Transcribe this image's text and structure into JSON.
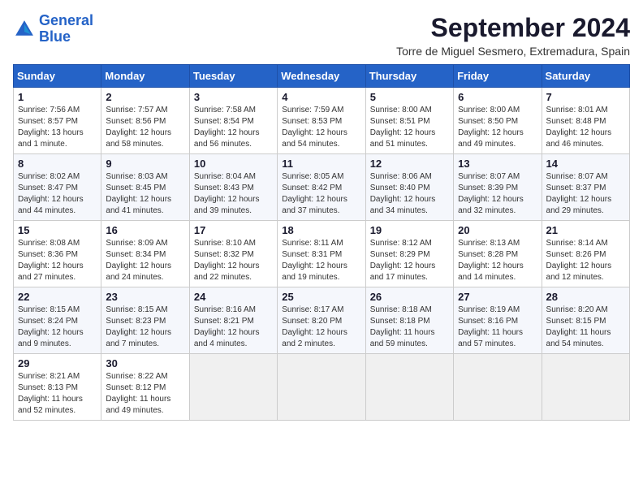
{
  "header": {
    "logo_line1": "General",
    "logo_line2": "Blue",
    "title": "September 2024",
    "subtitle": "Torre de Miguel Sesmero, Extremadura, Spain"
  },
  "weekdays": [
    "Sunday",
    "Monday",
    "Tuesday",
    "Wednesday",
    "Thursday",
    "Friday",
    "Saturday"
  ],
  "weeks": [
    [
      {
        "day": "1",
        "sr": "7:56 AM",
        "ss": "8:57 PM",
        "dl": "13 hours and 1 minute."
      },
      {
        "day": "2",
        "sr": "7:57 AM",
        "ss": "8:56 PM",
        "dl": "12 hours and 58 minutes."
      },
      {
        "day": "3",
        "sr": "7:58 AM",
        "ss": "8:54 PM",
        "dl": "12 hours and 56 minutes."
      },
      {
        "day": "4",
        "sr": "7:59 AM",
        "ss": "8:53 PM",
        "dl": "12 hours and 54 minutes."
      },
      {
        "day": "5",
        "sr": "8:00 AM",
        "ss": "8:51 PM",
        "dl": "12 hours and 51 minutes."
      },
      {
        "day": "6",
        "sr": "8:00 AM",
        "ss": "8:50 PM",
        "dl": "12 hours and 49 minutes."
      },
      {
        "day": "7",
        "sr": "8:01 AM",
        "ss": "8:48 PM",
        "dl": "12 hours and 46 minutes."
      }
    ],
    [
      {
        "day": "8",
        "sr": "8:02 AM",
        "ss": "8:47 PM",
        "dl": "12 hours and 44 minutes."
      },
      {
        "day": "9",
        "sr": "8:03 AM",
        "ss": "8:45 PM",
        "dl": "12 hours and 41 minutes."
      },
      {
        "day": "10",
        "sr": "8:04 AM",
        "ss": "8:43 PM",
        "dl": "12 hours and 39 minutes."
      },
      {
        "day": "11",
        "sr": "8:05 AM",
        "ss": "8:42 PM",
        "dl": "12 hours and 37 minutes."
      },
      {
        "day": "12",
        "sr": "8:06 AM",
        "ss": "8:40 PM",
        "dl": "12 hours and 34 minutes."
      },
      {
        "day": "13",
        "sr": "8:07 AM",
        "ss": "8:39 PM",
        "dl": "12 hours and 32 minutes."
      },
      {
        "day": "14",
        "sr": "8:07 AM",
        "ss": "8:37 PM",
        "dl": "12 hours and 29 minutes."
      }
    ],
    [
      {
        "day": "15",
        "sr": "8:08 AM",
        "ss": "8:36 PM",
        "dl": "12 hours and 27 minutes."
      },
      {
        "day": "16",
        "sr": "8:09 AM",
        "ss": "8:34 PM",
        "dl": "12 hours and 24 minutes."
      },
      {
        "day": "17",
        "sr": "8:10 AM",
        "ss": "8:32 PM",
        "dl": "12 hours and 22 minutes."
      },
      {
        "day": "18",
        "sr": "8:11 AM",
        "ss": "8:31 PM",
        "dl": "12 hours and 19 minutes."
      },
      {
        "day": "19",
        "sr": "8:12 AM",
        "ss": "8:29 PM",
        "dl": "12 hours and 17 minutes."
      },
      {
        "day": "20",
        "sr": "8:13 AM",
        "ss": "8:28 PM",
        "dl": "12 hours and 14 minutes."
      },
      {
        "day": "21",
        "sr": "8:14 AM",
        "ss": "8:26 PM",
        "dl": "12 hours and 12 minutes."
      }
    ],
    [
      {
        "day": "22",
        "sr": "8:15 AM",
        "ss": "8:24 PM",
        "dl": "12 hours and 9 minutes."
      },
      {
        "day": "23",
        "sr": "8:15 AM",
        "ss": "8:23 PM",
        "dl": "12 hours and 7 minutes."
      },
      {
        "day": "24",
        "sr": "8:16 AM",
        "ss": "8:21 PM",
        "dl": "12 hours and 4 minutes."
      },
      {
        "day": "25",
        "sr": "8:17 AM",
        "ss": "8:20 PM",
        "dl": "12 hours and 2 minutes."
      },
      {
        "day": "26",
        "sr": "8:18 AM",
        "ss": "8:18 PM",
        "dl": "11 hours and 59 minutes."
      },
      {
        "day": "27",
        "sr": "8:19 AM",
        "ss": "8:16 PM",
        "dl": "11 hours and 57 minutes."
      },
      {
        "day": "28",
        "sr": "8:20 AM",
        "ss": "8:15 PM",
        "dl": "11 hours and 54 minutes."
      }
    ],
    [
      {
        "day": "29",
        "sr": "8:21 AM",
        "ss": "8:13 PM",
        "dl": "11 hours and 52 minutes."
      },
      {
        "day": "30",
        "sr": "8:22 AM",
        "ss": "8:12 PM",
        "dl": "11 hours and 49 minutes."
      },
      null,
      null,
      null,
      null,
      null
    ]
  ]
}
